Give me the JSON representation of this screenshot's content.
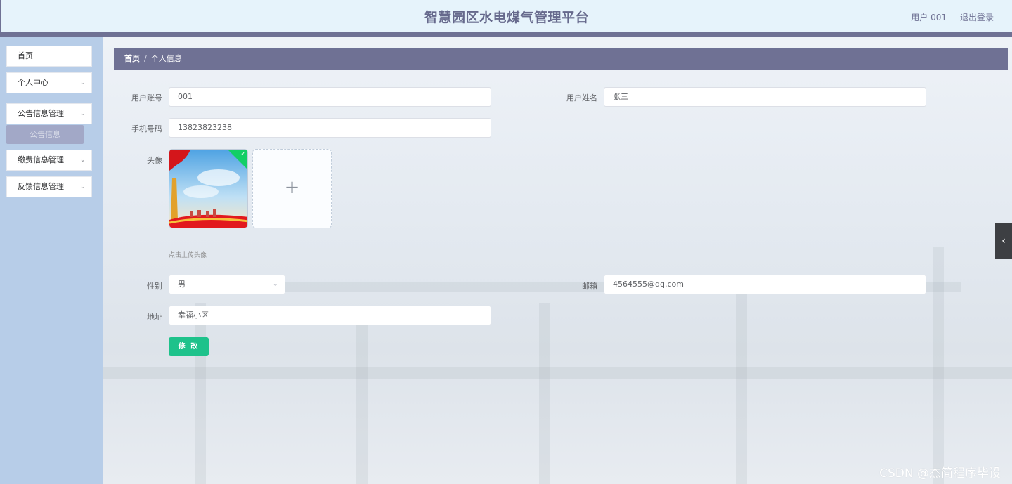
{
  "header": {
    "title": "智慧园区水电煤气管理平台",
    "user": "用户 001",
    "logout": "退出登录"
  },
  "sidebar": {
    "items": [
      {
        "label": "首页",
        "has_arrow": false
      },
      {
        "label": "个人中心",
        "has_arrow": true
      },
      {
        "label": "公告信息管理",
        "has_arrow": true
      },
      {
        "label": "缴费信息管理",
        "has_arrow": true
      },
      {
        "label": "反馈信息管理",
        "has_arrow": true
      }
    ],
    "submenu": {
      "label": "公告信息"
    }
  },
  "breadcrumb": {
    "home": "首页",
    "separator": "/",
    "current": "个人信息"
  },
  "form": {
    "account": {
      "label": "用户账号",
      "value": "001"
    },
    "name": {
      "label": "用户姓名",
      "value": "张三"
    },
    "phone": {
      "label": "手机号码",
      "value": "13823823238"
    },
    "avatar": {
      "label": "头像",
      "tip": "点击上传头像",
      "add_icon": "+",
      "checked_icon": "✓"
    },
    "gender": {
      "label": "性别",
      "value": "男"
    },
    "email": {
      "label": "邮箱",
      "value": "4564555@qq.com"
    },
    "address": {
      "label": "地址",
      "value": "幸福小区"
    },
    "submit": "修 改"
  },
  "chevron": "⌄",
  "side_toggle": "‹",
  "watermark": "CSDN @杰简程序毕设",
  "colors": {
    "accent": "#6f7194",
    "button": "#1ec28b",
    "sidebar": "#b7cde8",
    "header": "#e6f3fb"
  }
}
